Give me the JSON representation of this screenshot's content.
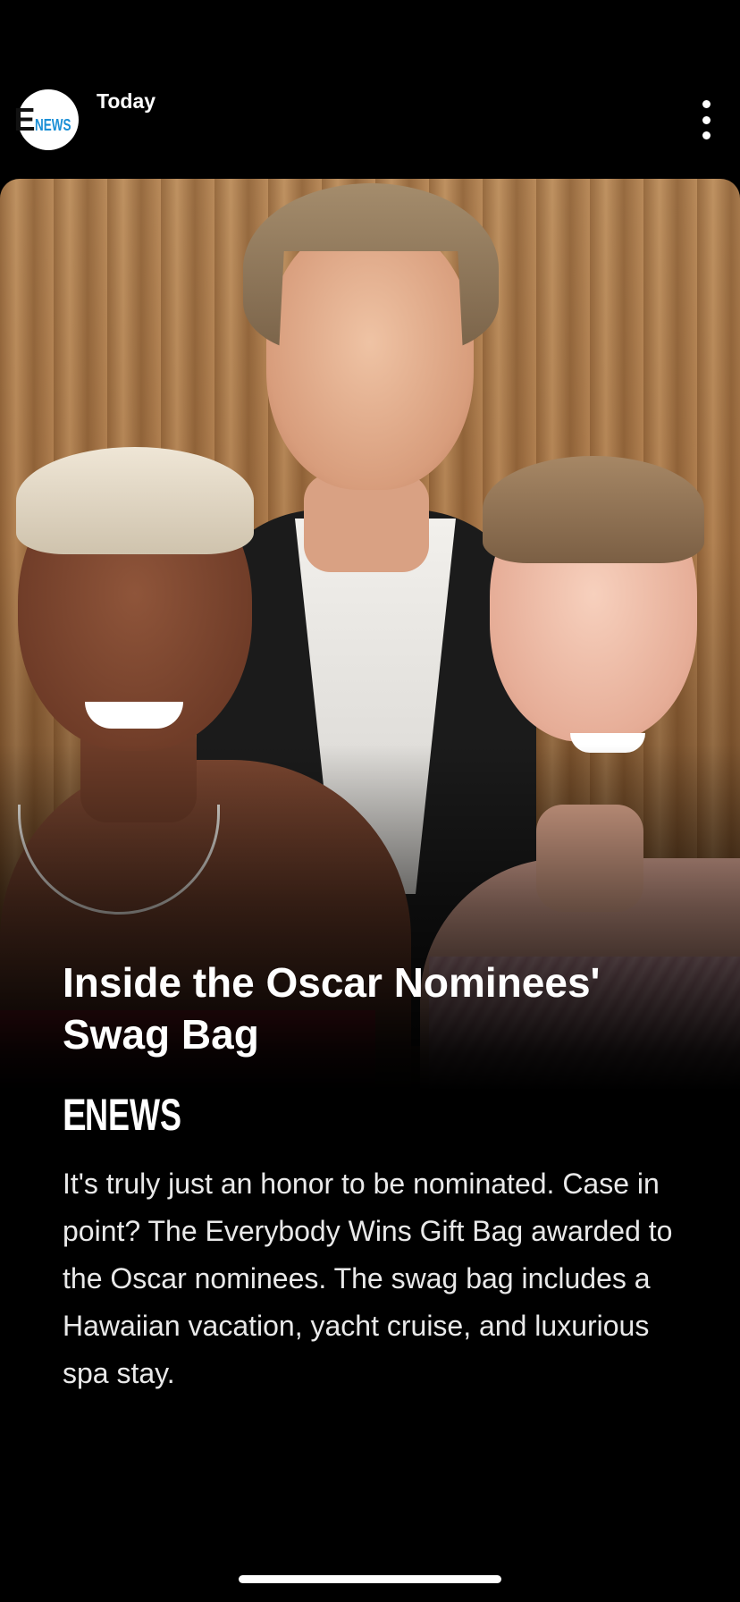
{
  "header": {
    "publisher_logo": {
      "letter": "E",
      "word": "NEWS"
    },
    "timestamp": "Today",
    "more_icon": "more-vertical-icon"
  },
  "story": {
    "image": "photo of three celebrities in front of a gold curtain",
    "headline": "Inside the Oscar Nominees' Swag Bag",
    "brand_logo": {
      "letter": "E",
      "word": "NEWS"
    },
    "body": "It's truly just an honor to be nominated. Case in point? The Everybody Wins Gift Bag awarded to the Oscar nominees. The swag bag includes a Hawaiian vacation, yacht cruise, and luxurious spa stay."
  },
  "colors": {
    "background": "#000000",
    "logo_accent": "#1a8fd6",
    "text_primary": "#ffffff",
    "text_body": "#e9e9e9"
  }
}
